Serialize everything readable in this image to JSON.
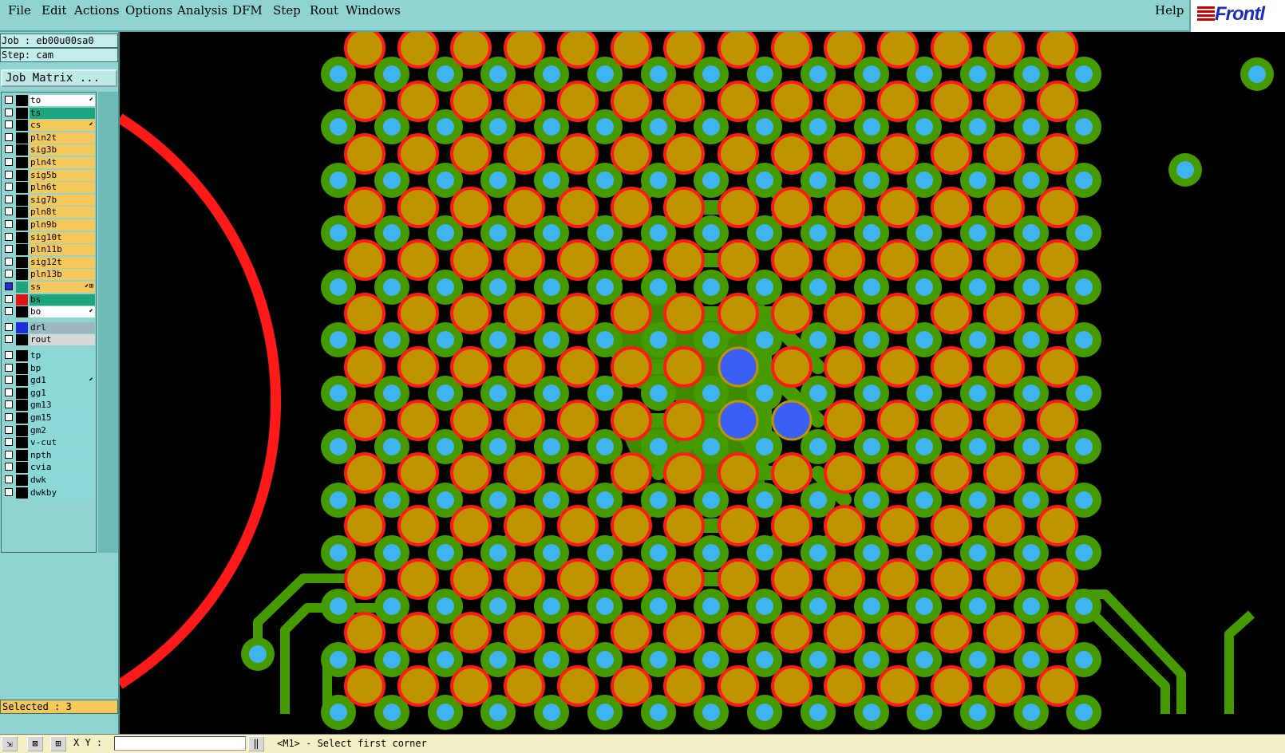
{
  "menubar": {
    "items": [
      {
        "label": "File",
        "key": "F"
      },
      {
        "label": "Edit",
        "key": "E"
      },
      {
        "label": "Actions",
        "key": "A"
      },
      {
        "label": "Options",
        "key": ""
      },
      {
        "label": "Analysis",
        "key": ""
      },
      {
        "label": "DFM",
        "key": ""
      },
      {
        "label": "Step",
        "key": "S"
      },
      {
        "label": "Rout",
        "key": "R"
      },
      {
        "label": "Windows",
        "key": "W"
      }
    ],
    "help": "Help",
    "logo": "Frontl"
  },
  "panel": {
    "job": "Job : eb00u00sa0",
    "step": "Step: cam",
    "job_matrix": "Job Matrix ..."
  },
  "layers": [
    {
      "name": "to",
      "bg": "#ffffff",
      "mark": "⬋",
      "chk": false,
      "col": "#000000"
    },
    {
      "name": "ts",
      "bg": "#1ca57c",
      "mark": "",
      "chk": false,
      "col": "#000000"
    },
    {
      "name": "cs",
      "bg": "#f5c85c",
      "mark": "⬋",
      "chk": false,
      "col": "#000000"
    },
    {
      "name": "pln2t",
      "bg": "#f5c85c",
      "mark": "",
      "chk": false,
      "col": "#000000"
    },
    {
      "name": "sig3b",
      "bg": "#f5c85c",
      "mark": "",
      "chk": false,
      "col": "#000000"
    },
    {
      "name": "pln4t",
      "bg": "#f5c85c",
      "mark": "",
      "chk": false,
      "col": "#000000"
    },
    {
      "name": "sig5b",
      "bg": "#f5c85c",
      "mark": "",
      "chk": false,
      "col": "#000000"
    },
    {
      "name": "pln6t",
      "bg": "#f5c85c",
      "mark": "",
      "chk": false,
      "col": "#000000"
    },
    {
      "name": "sig7b",
      "bg": "#f5c85c",
      "mark": "",
      "chk": false,
      "col": "#000000"
    },
    {
      "name": "pln8t",
      "bg": "#f5c85c",
      "mark": "",
      "chk": false,
      "col": "#000000"
    },
    {
      "name": "pln9b",
      "bg": "#f5c85c",
      "mark": "",
      "chk": false,
      "col": "#000000"
    },
    {
      "name": "sig10t",
      "bg": "#f5c85c",
      "mark": "",
      "chk": false,
      "col": "#000000"
    },
    {
      "name": "pln11b",
      "bg": "#f5c85c",
      "mark": "",
      "chk": false,
      "col": "#000000"
    },
    {
      "name": "sig12t",
      "bg": "#f5c85c",
      "mark": "",
      "chk": false,
      "col": "#000000"
    },
    {
      "name": "pln13b",
      "bg": "#f5c85c",
      "mark": "",
      "chk": false,
      "col": "#000000"
    },
    {
      "name": "ss",
      "bg": "#f5c85c",
      "mark": "⬋⊞",
      "chk": true,
      "col": "#1ca57c"
    },
    {
      "name": "bs",
      "bg": "#1ca57c",
      "mark": "",
      "chk": false,
      "col": "#e11414"
    },
    {
      "name": "bo",
      "bg": "#ffffff",
      "mark": "⬋",
      "chk": false,
      "col": "#000000"
    },
    {
      "name": "drl",
      "bg": "#9ab8c0",
      "mark": "",
      "chk": false,
      "col": "#1b2fd8"
    },
    {
      "name": "rout",
      "bg": "#d8d8d8",
      "mark": "",
      "chk": false,
      "col": "#000000"
    },
    {
      "name": "tp",
      "bg": "#8ad8d8",
      "mark": "",
      "chk": false,
      "col": "#000000"
    },
    {
      "name": "bp",
      "bg": "#8ad8d8",
      "mark": "",
      "chk": false,
      "col": "#000000"
    },
    {
      "name": "gd1",
      "bg": "#8ad8d8",
      "mark": "⬋",
      "chk": false,
      "col": "#000000"
    },
    {
      "name": "gg1",
      "bg": "#8ad8d8",
      "mark": "",
      "chk": false,
      "col": "#000000"
    },
    {
      "name": "gm13",
      "bg": "#8ad8d8",
      "mark": "",
      "chk": false,
      "col": "#000000"
    },
    {
      "name": "gm15",
      "bg": "#8ad8d8",
      "mark": "",
      "chk": false,
      "col": "#000000"
    },
    {
      "name": "gm2",
      "bg": "#8ad8d8",
      "mark": "",
      "chk": false,
      "col": "#000000"
    },
    {
      "name": "v-cut",
      "bg": "#8ad8d8",
      "mark": "",
      "chk": false,
      "col": "#000000"
    },
    {
      "name": "npth",
      "bg": "#8ad8d8",
      "mark": "",
      "chk": false,
      "col": "#000000"
    },
    {
      "name": "cvia",
      "bg": "#8ad8d8",
      "mark": "",
      "chk": false,
      "col": "#000000"
    },
    {
      "name": "dwk",
      "bg": "#8ad8d8",
      "mark": "",
      "chk": false,
      "col": "#000000"
    },
    {
      "name": "dwkby",
      "bg": "#8ad8d8",
      "mark": "",
      "chk": false,
      "col": "#000000"
    }
  ],
  "selected": "Selected : 3",
  "status": {
    "xy_label": "X Y :",
    "xy_value": "",
    "message": "<M1> - Select first corner"
  },
  "colors": {
    "pad": "#bf9400",
    "pad_outline": "#ff1a1a",
    "trace": "#459a00",
    "via_drill": "#3fb4f0",
    "selected_drill": "#3b5ff2",
    "board_outline": "#ff1a1a"
  }
}
